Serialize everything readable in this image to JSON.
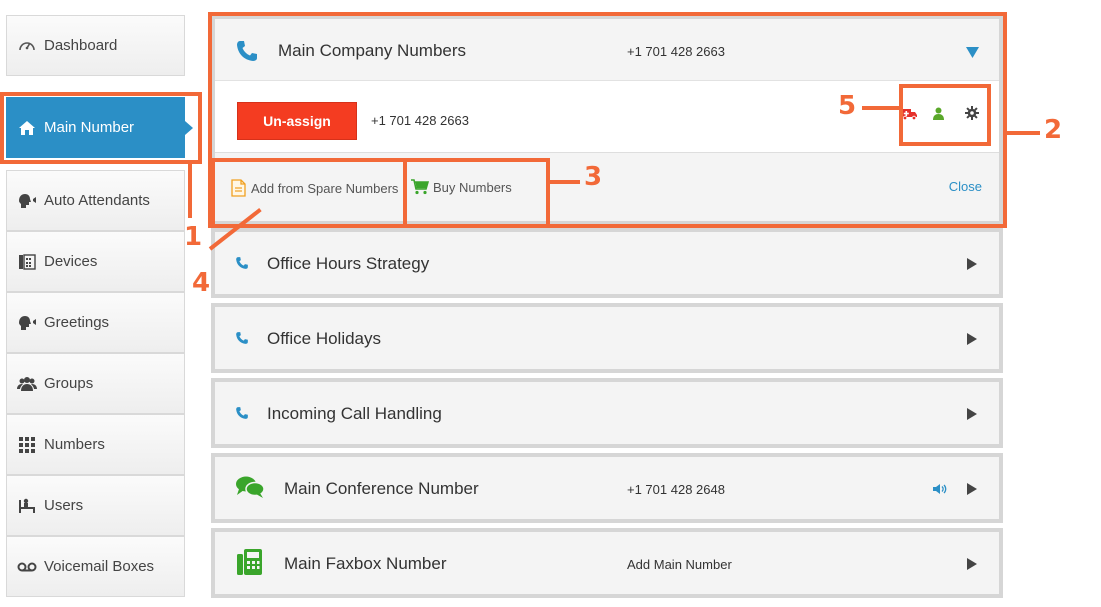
{
  "sidebar": {
    "items": [
      {
        "label": "Dashboard",
        "icon": "dashboard-icon"
      },
      {
        "label": "Main Number",
        "icon": "home-icon",
        "active": true
      },
      {
        "label": "Auto Attendants",
        "icon": "speaker-head-icon"
      },
      {
        "label": "Devices",
        "icon": "fax-device-icon"
      },
      {
        "label": "Greetings",
        "icon": "speaker-head-icon"
      },
      {
        "label": "Groups",
        "icon": "group-icon"
      },
      {
        "label": "Numbers",
        "icon": "grid-icon"
      },
      {
        "label": "Users",
        "icon": "user-desk-icon"
      },
      {
        "label": "Voicemail Boxes",
        "icon": "voicemail-icon"
      }
    ]
  },
  "main_panel": {
    "title": "Main Company Numbers",
    "number": "+1 701 428 2663",
    "unassign_label": "Un-assign",
    "assigned_number": "+1 701 428 2663",
    "add_spare_label": "Add from Spare Numbers",
    "buy_label": "Buy Numbers",
    "close_label": "Close"
  },
  "panels": [
    {
      "title": "Office Hours Strategy",
      "number": "",
      "icon": "phone-icon"
    },
    {
      "title": "Office Holidays",
      "number": "",
      "icon": "phone-icon"
    },
    {
      "title": "Incoming Call Handling",
      "number": "",
      "icon": "phone-icon"
    },
    {
      "title": "Main Conference Number",
      "number": "+1 701 428 2648",
      "icon": "chat-bubbles-icon"
    },
    {
      "title": "Main Faxbox Number",
      "number": "Add Main Number",
      "icon": "fax-icon"
    }
  ],
  "annotations": {
    "n1": "1",
    "n2": "2",
    "n3": "3",
    "n4": "4",
    "n5": "5"
  },
  "colors": {
    "accent": "#2b8fc6",
    "danger": "#f43c21",
    "annotation": "#f26938",
    "cart_green": "#3aa52b"
  }
}
